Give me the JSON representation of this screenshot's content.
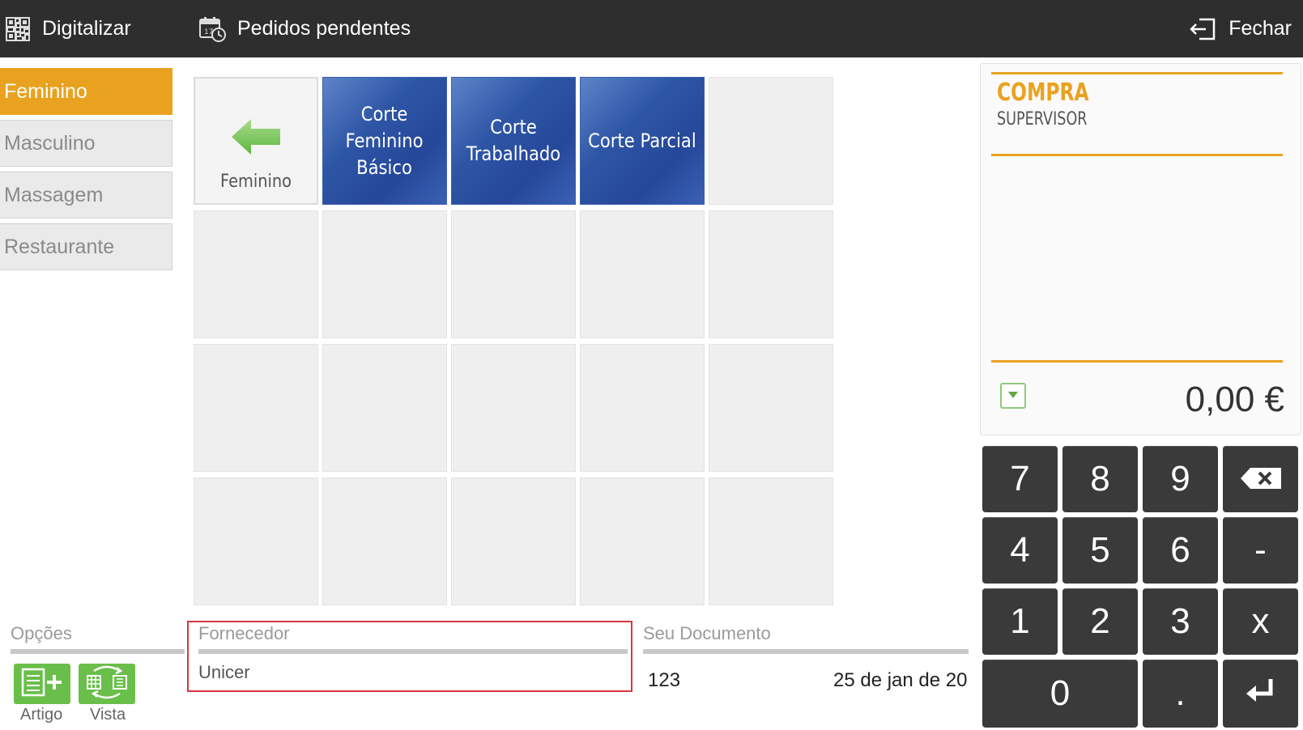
{
  "topbar": {
    "scan_label": "Digitalizar",
    "scan_icon": "qr-code-icon",
    "pending_label": "Pedidos pendentes",
    "pending_icon": "calendar-clock-icon",
    "close_label": "Fechar",
    "close_icon": "exit-icon"
  },
  "categories": [
    {
      "label": "Feminino",
      "active": true
    },
    {
      "label": "Masculino",
      "active": false
    },
    {
      "label": "Massagem",
      "active": false
    },
    {
      "label": "Restaurante",
      "active": false
    }
  ],
  "grid": {
    "back_label": "Feminino",
    "back_icon": "arrow-left-icon",
    "products": [
      {
        "label": "Corte\nFeminino\nBásico"
      },
      {
        "label": "Corte\nTrabalhado"
      },
      {
        "label": "Corte Parcial"
      }
    ]
  },
  "options": {
    "section_label": "Opções",
    "article_label": "Artigo",
    "article_icon": "add-article-icon",
    "view_label": "Vista",
    "view_icon": "switch-view-icon"
  },
  "supplier": {
    "label": "Fornecedor",
    "value": "Unicer"
  },
  "document": {
    "label": "Seu Documento",
    "number": "123",
    "date": "25 de jan de 20"
  },
  "receipt": {
    "title": "COMPRA",
    "subtitle": "SUPERVISOR",
    "total": "0,00 €",
    "dropdown_icon": "chevron-down-icon"
  },
  "keypad": {
    "k7": "7",
    "k8": "8",
    "k9": "9",
    "k4": "4",
    "k5": "5",
    "k6": "6",
    "kminus": "-",
    "k1": "1",
    "k2": "2",
    "k3": "3",
    "kx": "x",
    "k0": "0",
    "kdot": ".",
    "backspace_icon": "backspace-icon",
    "enter_icon": "enter-icon"
  },
  "colors": {
    "accent": "#e9a21f",
    "topbar": "#2e2e2e",
    "product_tile": "#2e56a6",
    "keypad": "#3a3a3a",
    "option_button": "#6abf4b",
    "highlight_border": "#d9363e"
  }
}
